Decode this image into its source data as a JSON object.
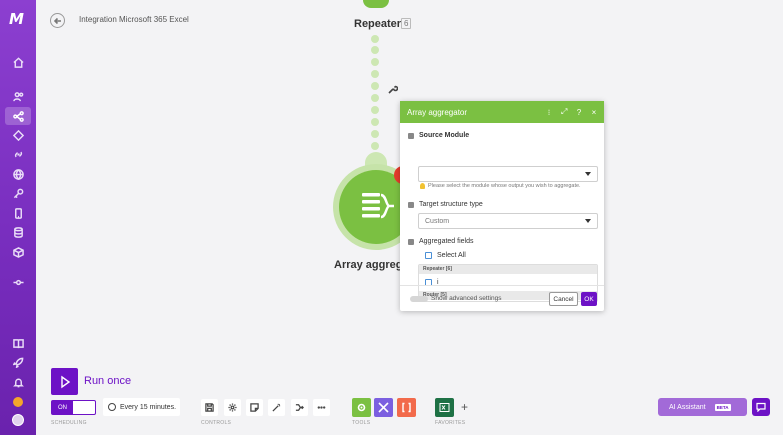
{
  "sidebar": {
    "logo_text": "M",
    "items": [
      {
        "icon": "home-icon"
      },
      {
        "icon": "team-icon"
      },
      {
        "icon": "scenarios-icon"
      },
      {
        "icon": "templates-icon"
      },
      {
        "icon": "connections-icon"
      },
      {
        "icon": "webhooks-icon"
      },
      {
        "icon": "keys-icon"
      },
      {
        "icon": "devices-icon"
      },
      {
        "icon": "datastores-icon"
      },
      {
        "icon": "datastructures-icon"
      },
      {
        "icon": "flow-control-icon"
      },
      {
        "icon": "docs-icon"
      },
      {
        "icon": "rocket-icon"
      },
      {
        "icon": "notifications-icon"
      },
      {
        "icon": "help-icon"
      },
      {
        "icon": "user-avatar"
      }
    ]
  },
  "header": {
    "title": "Integration Microsoft 365 Excel"
  },
  "canvas": {
    "repeater": {
      "label": "Repeater",
      "badge": "6"
    },
    "aggregator": {
      "label": "Array aggregator"
    }
  },
  "dialog": {
    "title": "Array aggregator",
    "header_buttons": [
      "⁝",
      "⤢",
      "?",
      "×"
    ],
    "source_module": {
      "label": "Source Module",
      "value": "",
      "hint": "Please select the module whose output you wish to aggregate."
    },
    "target_structure": {
      "label": "Target structure type",
      "value": "Custom"
    },
    "aggregated_fields": {
      "label": "Aggregated fields",
      "select_all": "Select All",
      "groups": [
        {
          "name": "Repeater [6]",
          "fields": [
            "i"
          ]
        },
        {
          "name": "Router [5]",
          "fields": []
        }
      ]
    },
    "advanced_label": "Show advanced settings",
    "cancel": "Cancel",
    "ok": "OK"
  },
  "toolbar": {
    "run_once": "Run once",
    "scheduling": {
      "toggle": "ON",
      "interval": "Every 15 minutes.",
      "section": "SCHEDULING"
    },
    "controls_section": "CONTROLS",
    "tools_section": "TOOLS",
    "favorites_section": "FAVORITES",
    "ai_assistant": "AI Assistant",
    "ai_beta": "BETA"
  },
  "colors": {
    "brand_purple": "#6d12c6",
    "module_green": "#7bc042",
    "router_red": "#e53b2c",
    "tool_orange": "#f26a4b",
    "tool_purple": "#7b5fe0",
    "excel_green": "#1e7145"
  }
}
